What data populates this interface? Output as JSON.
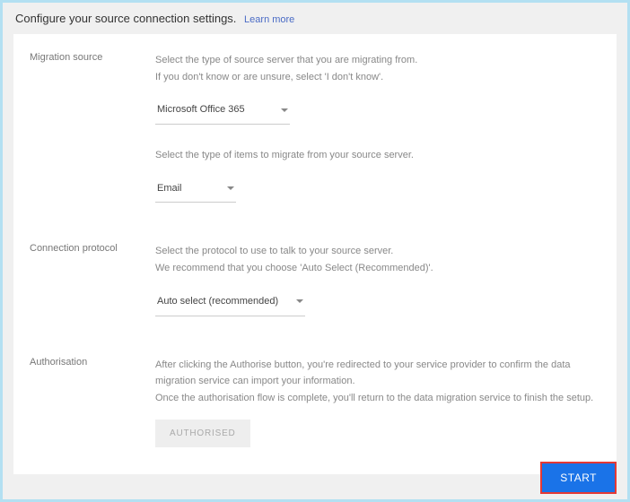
{
  "header": {
    "title": "Configure your source connection settings.",
    "learn_more": "Learn more"
  },
  "migration_source": {
    "label": "Migration source",
    "desc1": "Select the type of source server that you are migrating from.",
    "desc2": "If you don't know or are unsure, select 'I don't know'.",
    "dropdown1_value": "Microsoft Office 365",
    "desc3": "Select the type of items to migrate from your source server.",
    "dropdown2_value": "Email"
  },
  "connection_protocol": {
    "label": "Connection protocol",
    "desc1": "Select the protocol to use to talk to your source server.",
    "desc2": "We recommend that you choose 'Auto Select (Recommended)'.",
    "dropdown_value": "Auto select (recommended)"
  },
  "authorisation": {
    "label": "Authorisation",
    "desc1": "After clicking the Authorise button, you're redirected to your service provider to confirm the data migration service can import your information.",
    "desc2": "Once the authorisation flow is complete, you'll return to the data migration service to finish the setup.",
    "button": "AUTHORISED"
  },
  "start_button": "START"
}
